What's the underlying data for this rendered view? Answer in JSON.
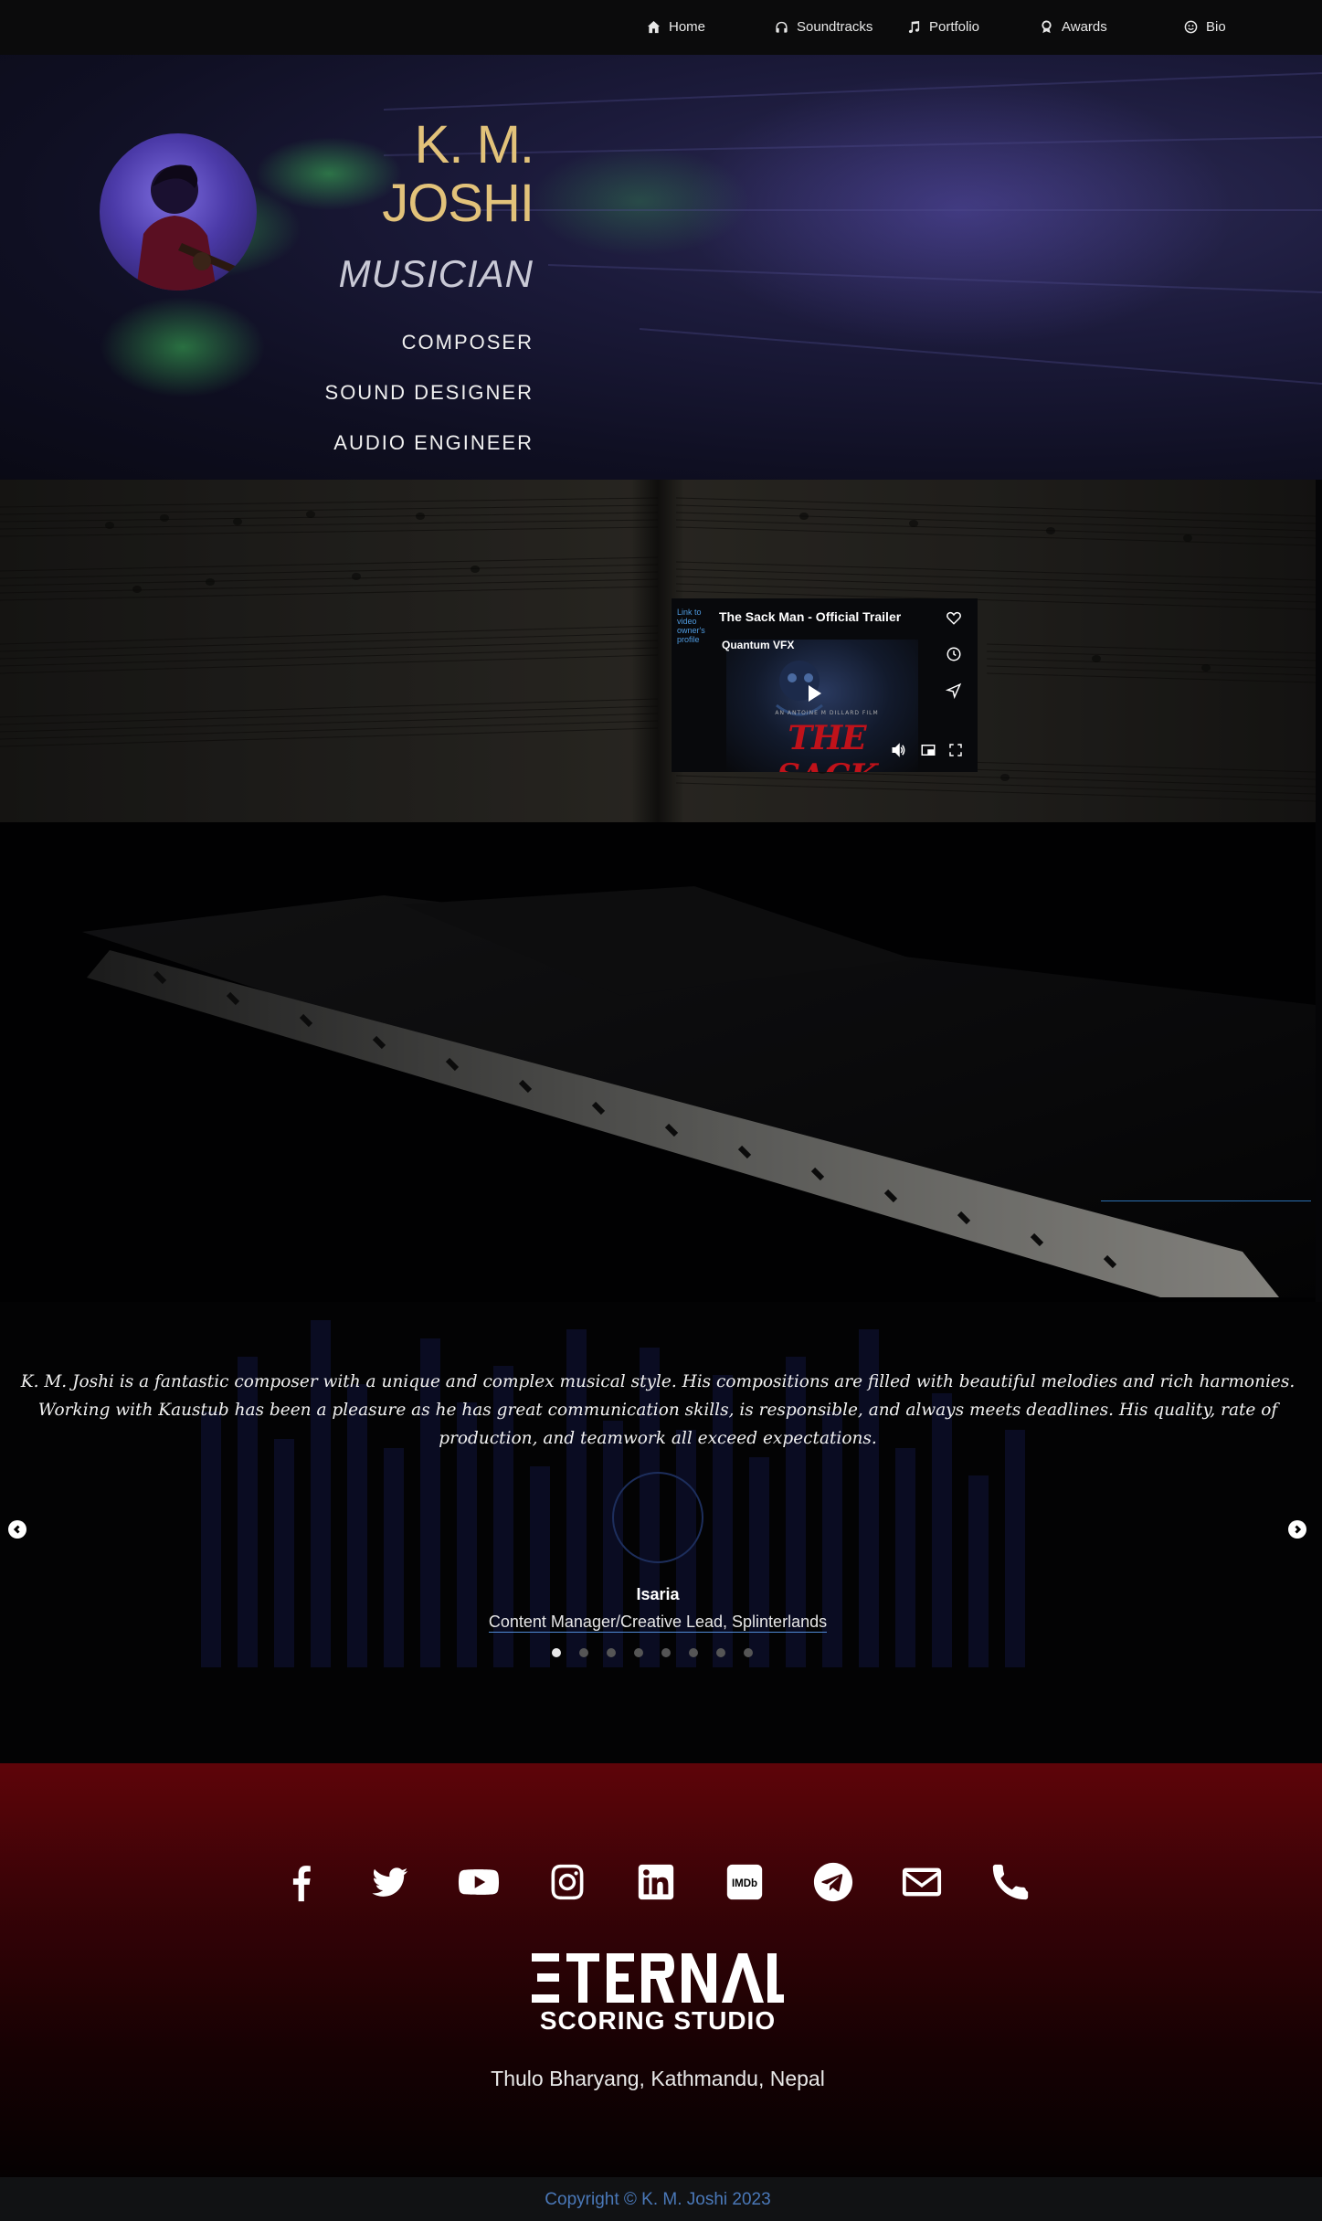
{
  "nav": {
    "items": [
      {
        "label": "Home",
        "icon": "home-icon"
      },
      {
        "label": "Soundtracks",
        "icon": "headphones-icon"
      },
      {
        "label": "Portfolio",
        "icon": "music-note-icon"
      },
      {
        "label": "Awards",
        "icon": "award-icon"
      },
      {
        "label": "Bio",
        "icon": "smile-icon"
      }
    ]
  },
  "hero": {
    "name_line1": "K. M.",
    "name_line2": "JOSHI",
    "role": "MUSICIAN",
    "skills": [
      "COMPOSER",
      "SOUND DESIGNER",
      "AUDIO ENGINEER"
    ]
  },
  "video": {
    "title": "The Sack Man - Official Trailer",
    "channel": "Quantum VFX",
    "avatar_alt": "Link to video owner's profile",
    "poster_title": "THE SACK MAN",
    "poster_credit": "AN ANTOINE M DILLARD FILM"
  },
  "testimonial": {
    "quote": "K. M. Joshi is a fantastic composer with a unique and complex musical style. His compositions are filled with beautiful melodies and rich harmonies. Working with Kaustub has been a pleasure as he has great communication skills, is responsible, and always meets deadlines. His quality, rate of production, and teamwork all exceed expectations.",
    "name": "Isaria",
    "role": "Content Manager/Creative Lead, Splinterlands",
    "slide_count": 8,
    "active_slide": 1
  },
  "footer": {
    "social": [
      "facebook-icon",
      "twitter-icon",
      "youtube-icon",
      "instagram-icon",
      "linkedin-icon",
      "imdb-icon",
      "telegram-icon",
      "email-icon",
      "phone-icon"
    ],
    "imdb_text": "IMDb",
    "logo_top": "ETERNAL",
    "logo_bottom": "SCORING STUDIO",
    "address": "Thulo Bharyang, Kathmandu, Nepal",
    "copyright": "Copyright © K. M. Joshi 2023"
  },
  "colors": {
    "accent_gold": "#e2c27a",
    "link_blue": "#4a78b8",
    "footer_red": "#5e0409"
  }
}
